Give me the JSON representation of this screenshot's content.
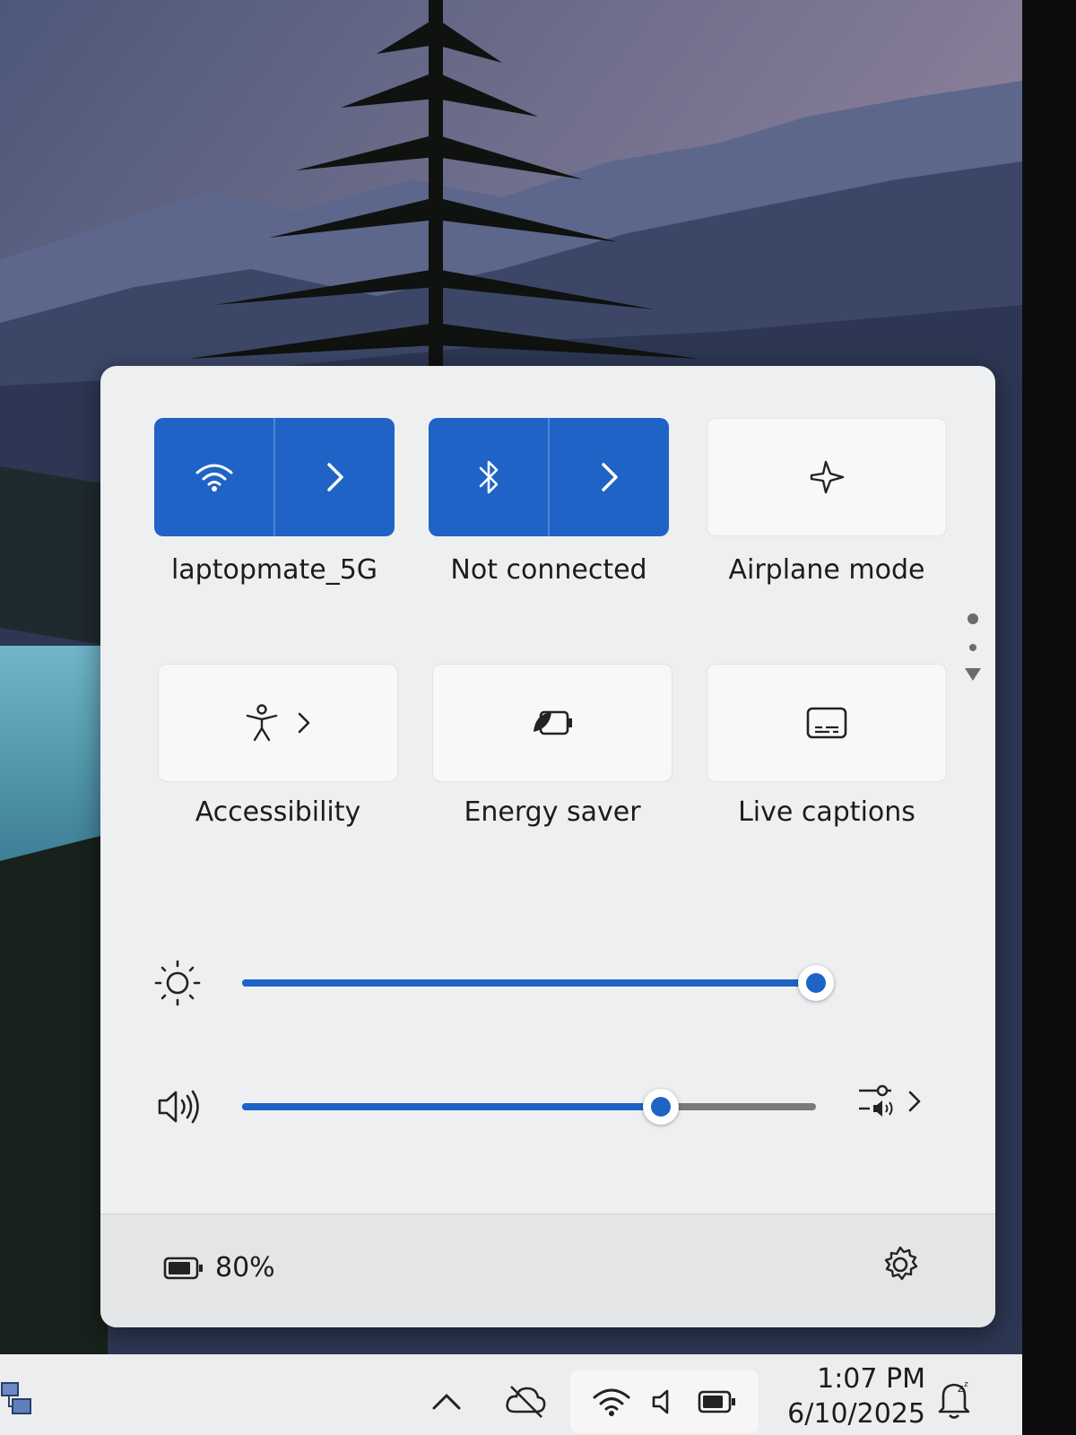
{
  "quick_settings": {
    "tiles": [
      {
        "label": "laptopmate_5G",
        "state": "on",
        "icon": "wifi-icon",
        "has_chevron": true
      },
      {
        "label": "Not connected",
        "state": "on",
        "icon": "bluetooth-icon",
        "has_chevron": true
      },
      {
        "label": "Airplane mode",
        "state": "off",
        "icon": "airplane-icon",
        "has_chevron": false
      },
      {
        "label": "Accessibility",
        "state": "off",
        "icon": "accessibility-icon",
        "has_chevron": true
      },
      {
        "label": "Energy saver",
        "state": "off",
        "icon": "energy-saver-icon",
        "has_chevron": false
      },
      {
        "label": "Live captions",
        "state": "off",
        "icon": "live-captions-icon",
        "has_chevron": false
      }
    ],
    "brightness": {
      "icon": "brightness-icon",
      "level": 1.0
    },
    "volume": {
      "icon": "speaker-icon",
      "level": 0.73
    },
    "footer": {
      "battery_icon": "battery-icon",
      "battery_text": "80%",
      "settings_icon": "gear-icon"
    }
  },
  "taskbar": {
    "time": "1:07 PM",
    "date": "6/10/2025",
    "icons": [
      "network-app-icon",
      "chevron-up-icon",
      "cloud-off-icon",
      "wifi-icon",
      "speaker-icon",
      "battery-icon",
      "notifications-dnd-icon"
    ]
  },
  "colors": {
    "accent": "#1f63c6",
    "panel": "#eeeff0",
    "track_off": "#7a7a7a"
  }
}
